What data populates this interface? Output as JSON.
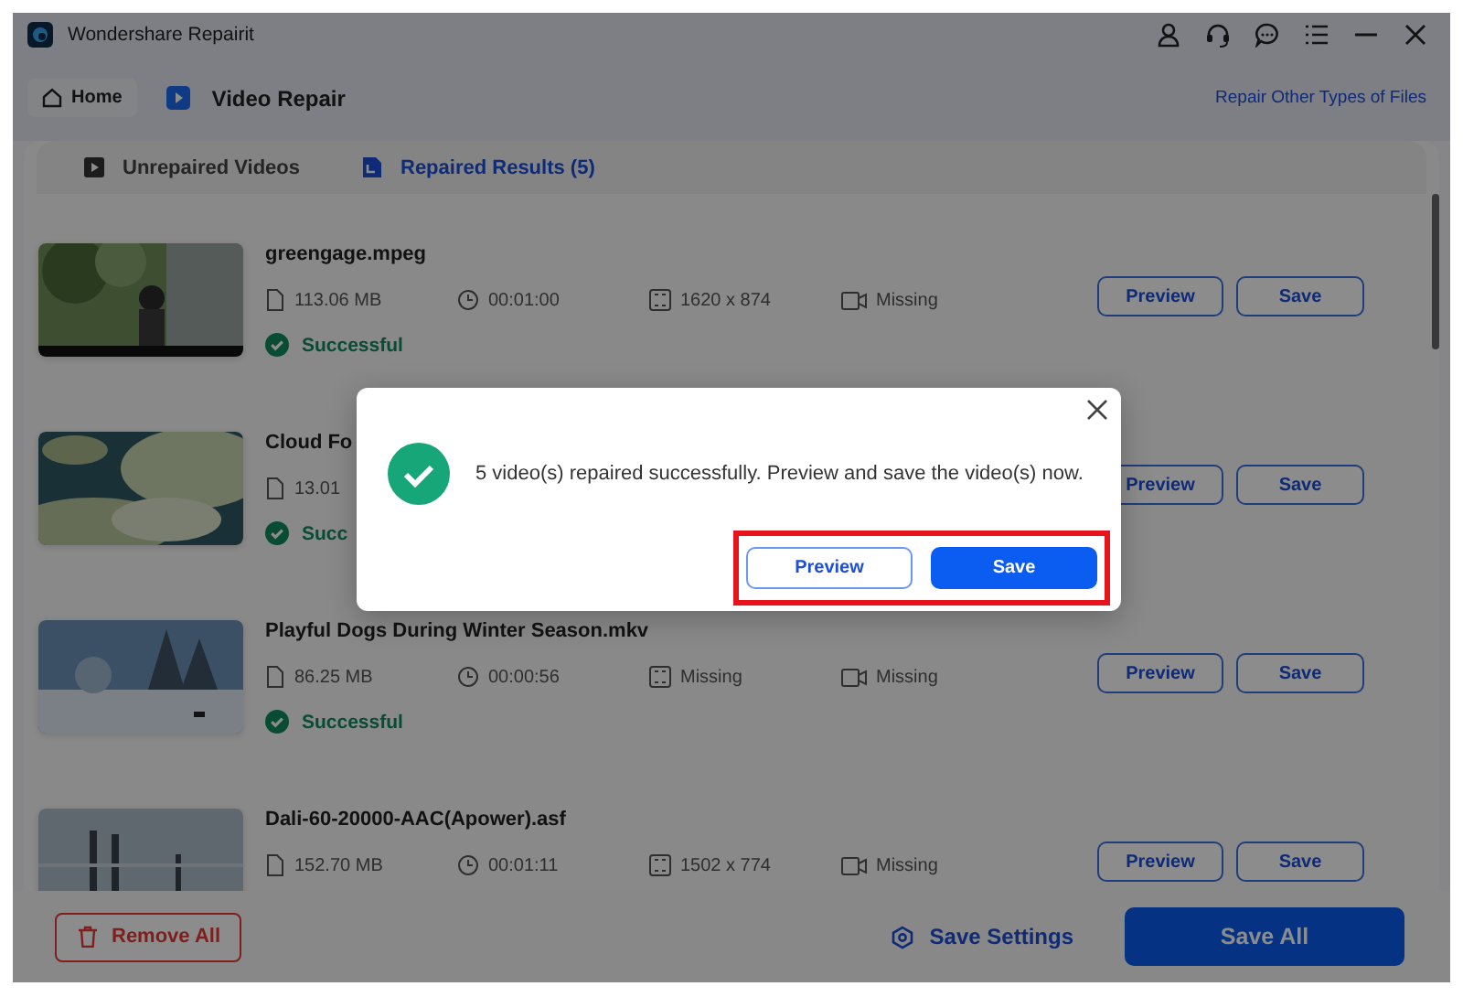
{
  "window": {
    "title": "Wondershare Repairit"
  },
  "nav": {
    "home": "Home",
    "section": "Video Repair",
    "link": "Repair Other Types of Files"
  },
  "tabs": [
    {
      "label": "Unrepaired Videos",
      "selected": false
    },
    {
      "label": "Repaired Results (5)",
      "selected": true
    }
  ],
  "videos": [
    {
      "name": "greengage.mpeg",
      "size": "113.06 MB",
      "duration": "00:01:00",
      "resolution": "1620 x 874",
      "codec": "Missing",
      "status": "Successful",
      "preview": "Preview",
      "save": "Save"
    },
    {
      "name": "Cloud Fo",
      "size": "13.01",
      "status": "Succ",
      "preview": "Preview",
      "save": "Save"
    },
    {
      "name": "Playful Dogs During Winter Season.mkv",
      "size": "86.25 MB",
      "duration": "00:00:56",
      "resolution": "Missing",
      "codec": "Missing",
      "status": "Successful",
      "preview": "Preview",
      "save": "Save"
    },
    {
      "name": "Dali-60-20000-AAC(Apower).asf",
      "size": "152.70 MB",
      "duration": "00:01:11",
      "resolution": "1502 x 774",
      "codec": "Missing",
      "preview": "Preview",
      "save": "Save"
    }
  ],
  "footer": {
    "remove_all": "Remove All",
    "save_settings": "Save Settings",
    "save_all": "Save All"
  },
  "dialog": {
    "message": "5 video(s) repaired successfully. Preview and save the video(s) now.",
    "highlighted": true,
    "buttons": [
      {
        "label": "Preview",
        "kind": "secondary"
      },
      {
        "label": "Save",
        "kind": "primary"
      }
    ]
  }
}
